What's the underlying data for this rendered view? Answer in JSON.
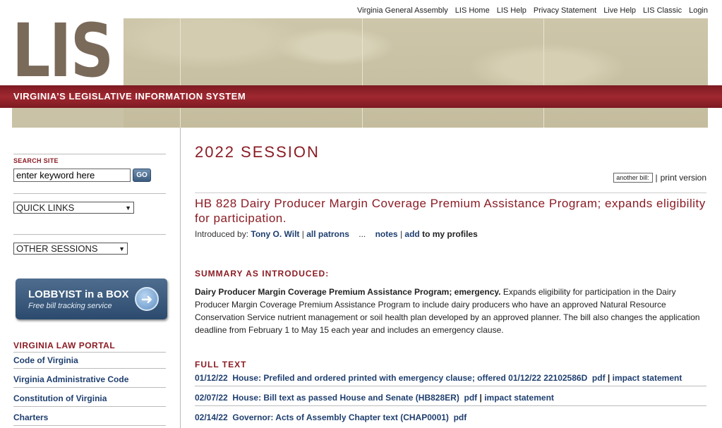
{
  "top_links": [
    "Virginia General Assembly",
    "LIS Home",
    "LIS Help",
    "Privacy Statement",
    "Live Help",
    "LIS Classic",
    "Login"
  ],
  "banner": {
    "logo": "LIS",
    "tagline": "VIRGINIA’S LEGISLATIVE INFORMATION SYSTEM"
  },
  "sidebar": {
    "search_label": "SEARCH SITE",
    "search_value": "enter keyword here",
    "go_label": "GO",
    "quick_links": "QUICK LINKS",
    "other_sessions": "OTHER SESSIONS",
    "lobbyist_title": "LOBBYIST in a BOX",
    "lobbyist_sub": "Free bill tracking service",
    "portal_title": "VIRGINIA LAW PORTAL",
    "portal_links": [
      "Code of Virginia",
      "Virginia Administrative Code",
      "Constitution of Virginia",
      "Charters"
    ]
  },
  "main": {
    "session": "2022 SESSION",
    "another_bill": "another bill:",
    "print_version": "print version",
    "bill_title": "HB 828 Dairy Producer Margin Coverage Premium Assistance Program; expands eligibility for participation.",
    "introduced_by": "Introduced by:",
    "patron": "Tony O. Wilt",
    "all_patrons": "all patrons",
    "ellipsis": "...",
    "notes": "notes",
    "add": "add",
    "to_profiles": "to my profiles",
    "summary_heading": "SUMMARY AS INTRODUCED:",
    "summary_bold": "Dairy Producer Margin Coverage Premium Assistance Program; emergency.",
    "summary_text": "Expands eligibility for participation in the Dairy Producer Margin Coverage Premium Assistance Program to include dairy producers who have an approved Natural Resource Conservation Service nutrient management or soil health plan developed by an approved planner. The bill also changes the application deadline from February 1 to May 15 each year and includes an emergency clause.",
    "full_text_heading": "FULL TEXT",
    "full_text": [
      {
        "date": "01/12/22",
        "desc": "House: Prefiled and ordered printed with emergency clause; offered 01/12/22 22102586D",
        "pdf": "pdf",
        "impact": "impact statement"
      },
      {
        "date": "02/07/22",
        "desc": "House: Bill text as passed House and Senate (HB828ER)",
        "pdf": "pdf",
        "impact": "impact statement"
      },
      {
        "date": "02/14/22",
        "desc": "Governor: Acts of Assembly Chapter text (CHAP0001)",
        "pdf": "pdf",
        "impact": ""
      }
    ]
  }
}
